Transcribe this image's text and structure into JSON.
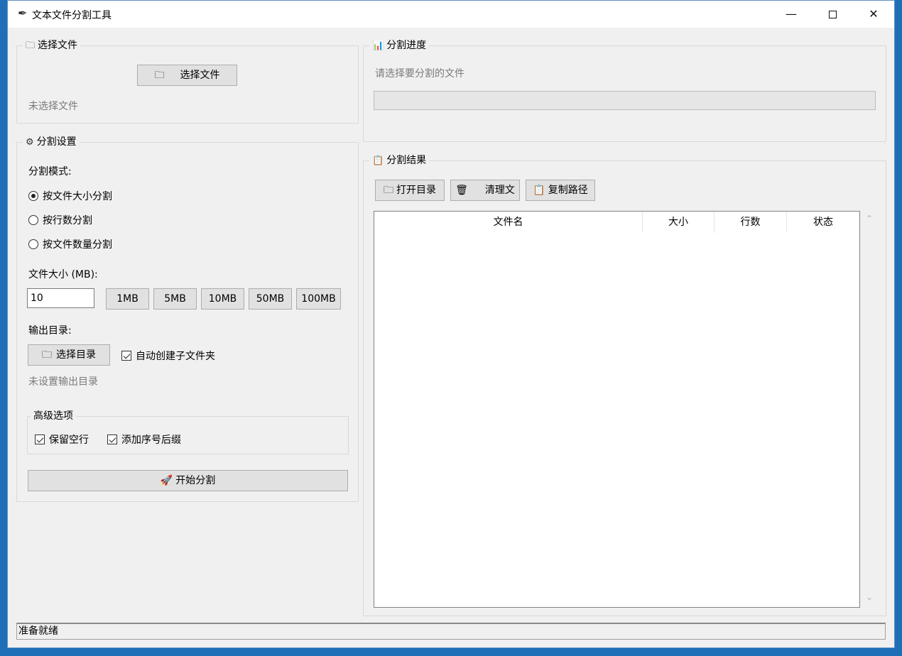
{
  "window": {
    "title": "文本文件分割工具",
    "minimize": "—",
    "close": "✕"
  },
  "file_group": {
    "title": "选择文件",
    "button": "选择文件",
    "status": "未选择文件"
  },
  "settings": {
    "title": "分割设置",
    "mode_label": "分割模式:",
    "modes": [
      {
        "label": "按文件大小分割",
        "selected": true
      },
      {
        "label": "按行数分割",
        "selected": false
      },
      {
        "label": "按文件数量分割",
        "selected": false
      }
    ],
    "size_label": "文件大小 (MB):",
    "size_value": "10",
    "presets": [
      "1MB",
      "5MB",
      "10MB",
      "50MB",
      "100MB"
    ],
    "output_label": "输出目录:",
    "select_dir_button": "选择目录",
    "auto_subfolder": {
      "label": "自动创建子文件夹",
      "checked": true
    },
    "output_status": "未设置输出目录",
    "advanced": {
      "title": "高级选项",
      "keep_blank": {
        "label": "保留空行",
        "checked": true
      },
      "add_suffix": {
        "label": "添加序号后缀",
        "checked": true
      }
    },
    "start_button": "开始分割"
  },
  "progress_group": {
    "title": "分割进度",
    "status": "请选择要分割的文件",
    "progress": 0
  },
  "results": {
    "title": "分割结果",
    "open_dir_button": "打开目录",
    "clear_button": "清理文",
    "copy_path_button": "复制路径",
    "columns": [
      "文件名",
      "大小",
      "行数",
      "状态"
    ],
    "rows": []
  },
  "statusbar": {
    "text": "准备就绪"
  },
  "colors": {
    "desktop": "#1f6fb8",
    "window_bg": "#f0f0f0",
    "muted_text": "#7a7a7a"
  },
  "icons": {
    "app": "feather-icon",
    "folder": "folder-icon",
    "gear": "gear-icon",
    "chart": "bar-chart-icon",
    "clipboard": "clipboard-icon",
    "trash": "trash-icon",
    "rocket": "rocket-icon"
  }
}
